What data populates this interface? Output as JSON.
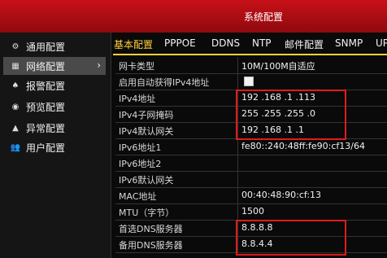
{
  "window": {
    "title": "系统配置"
  },
  "sidebar": {
    "items": [
      {
        "icon": "gear-icon",
        "label": "通用配置",
        "active": false
      },
      {
        "icon": "network-icon",
        "label": "网络配置",
        "active": true
      },
      {
        "icon": "bell-icon",
        "label": "报警配置",
        "active": false
      },
      {
        "icon": "eye-icon",
        "label": "预览配置",
        "active": false
      },
      {
        "icon": "warning-icon",
        "label": "异常配置",
        "active": false
      },
      {
        "icon": "users-icon",
        "label": "用户配置",
        "active": false
      }
    ]
  },
  "tabs": [
    {
      "label": "基本配置",
      "active": true
    },
    {
      "label": "PPPOE",
      "active": false
    },
    {
      "label": "DDNS",
      "active": false
    },
    {
      "label": "NTP",
      "active": false
    },
    {
      "label": "邮件配置",
      "active": false
    },
    {
      "label": "SNMP",
      "active": false
    },
    {
      "label": "UP",
      "active": false
    }
  ],
  "settings": [
    {
      "label": "网卡类型",
      "value": "10M/100M自适应"
    },
    {
      "label": "启用自动获得IPv4地址",
      "value": "",
      "checkbox": true
    },
    {
      "label": "IPv4地址",
      "value": "192 .168 .1    .113"
    },
    {
      "label": "IPv4子网掩码",
      "value": "255 .255 .255 .0"
    },
    {
      "label": "IPv4默认网关",
      "value": "192 .168 .1    .1"
    },
    {
      "label": "IPv6地址1",
      "value": "fe80::240:48ff:fe90:cf13/64"
    },
    {
      "label": "IPv6地址2",
      "value": ""
    },
    {
      "label": "IPv6默认网关",
      "value": ""
    },
    {
      "label": "MAC地址",
      "value": "00:40:48:90:cf:13"
    },
    {
      "label": "MTU（字节）",
      "value": "1500"
    },
    {
      "label": "首选DNS服务器",
      "value": "8.8.8.8"
    },
    {
      "label": "备用DNS服务器",
      "value": "8.8.4.4"
    }
  ],
  "colors": {
    "accent": "#ffd23a",
    "titlebar": "#b50f16",
    "highlight_box": "#e01b1b"
  }
}
